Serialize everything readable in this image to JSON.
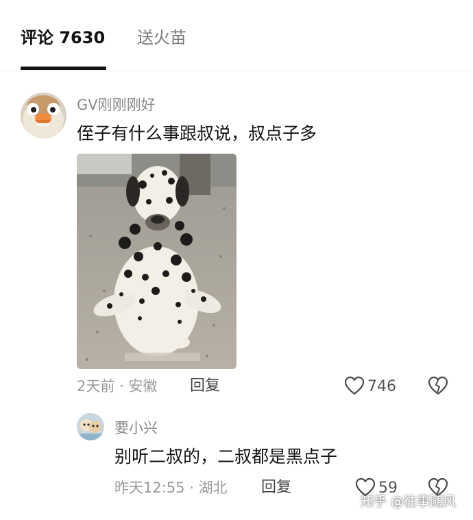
{
  "tabs": {
    "comments_label": "评论 7630",
    "fire_label": "送火苗"
  },
  "comments": [
    {
      "username": "GV刚刚刚好",
      "text": "侄子有什么事跟叔说，叔点子多",
      "time": "2天前",
      "separator": "·",
      "location": "安徽",
      "reply_label": "回复",
      "likes": "746",
      "image": "dalmatian-dog-photo"
    },
    {
      "username": "要小兴",
      "text": "别听二叔的，二叔都是黑点子",
      "time": "昨天12:55",
      "separator": "·",
      "location": "湖北",
      "reply_label": "回复",
      "likes": "59"
    }
  ],
  "watermark": "知乎 @往事随风",
  "colors": {
    "text_primary": "#141414",
    "text_secondary": "#8a8a8a",
    "tab_inactive": "#7b7b7b",
    "divider": "#ececec"
  }
}
